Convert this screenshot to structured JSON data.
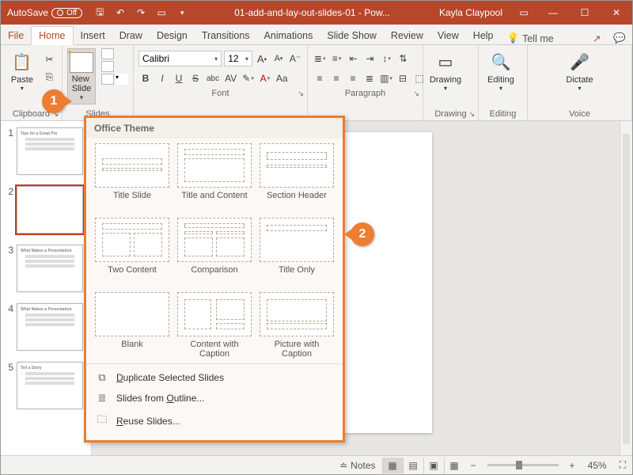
{
  "title": {
    "autosave_label": "AutoSave",
    "autosave_state": "Off",
    "file": "01-add-and-lay-out-slides-01 - Pow...",
    "user": "Kayla Claypool"
  },
  "tabs": {
    "file": "File",
    "items": [
      "Home",
      "Insert",
      "Draw",
      "Design",
      "Transitions",
      "Animations",
      "Slide Show",
      "Review",
      "View",
      "Help"
    ],
    "active_index": 0,
    "tell_me": "Tell me"
  },
  "ribbon": {
    "clipboard": {
      "label": "Clipboard",
      "paste": "Paste"
    },
    "slides": {
      "label": "Slides",
      "new_slide": "New\nSlide"
    },
    "font": {
      "label": "Font",
      "name": "Calibri",
      "size": "12",
      "bold": "B",
      "italic": "I",
      "underline": "U",
      "strike": "S",
      "shadow": "abc",
      "spacing": "AV",
      "grow": "A",
      "shrink": "A",
      "clear": "A",
      "changecase": "Aa"
    },
    "paragraph": {
      "label": "Paragraph"
    },
    "drawing": {
      "label": "Drawing",
      "btn": "Drawing"
    },
    "editing": {
      "label": "Editing",
      "btn": "Editing"
    },
    "voice": {
      "label": "Voice",
      "dictate": "Dictate"
    }
  },
  "gallery": {
    "header": "Office Theme",
    "layouts": [
      {
        "name": "Title Slide",
        "cls": "l-title"
      },
      {
        "name": "Title and Content",
        "cls": "l-tc"
      },
      {
        "name": "Section Header",
        "cls": "l-sh"
      },
      {
        "name": "Two Content",
        "cls": "l-two"
      },
      {
        "name": "Comparison",
        "cls": "l-cmp"
      },
      {
        "name": "Title Only",
        "cls": "l-to"
      },
      {
        "name": "Blank",
        "cls": "l-blank"
      },
      {
        "name": "Content with Caption",
        "cls": "l-cwc"
      },
      {
        "name": "Picture with Caption",
        "cls": "l-pwc"
      }
    ],
    "menu": {
      "duplicate": "Duplicate Selected Slides",
      "outline": "Slides from Outline...",
      "reuse": "Reuse Slides..."
    }
  },
  "thumbs": {
    "items": [
      {
        "num": "1",
        "title": "Tips for a Great Pre"
      },
      {
        "num": "2",
        "title": ""
      },
      {
        "num": "3",
        "title": "What Makes a Presentation"
      },
      {
        "num": "4",
        "title": "What Makes a Presentation"
      },
      {
        "num": "5",
        "title": "Tell a Story"
      }
    ],
    "selected_index": 1
  },
  "statusbar": {
    "notes": "Notes",
    "zoom": "45%"
  },
  "callouts": {
    "c1": "1",
    "c2": "2"
  },
  "colors": {
    "accent": "#b7472a",
    "callout": "#ed7d31"
  }
}
